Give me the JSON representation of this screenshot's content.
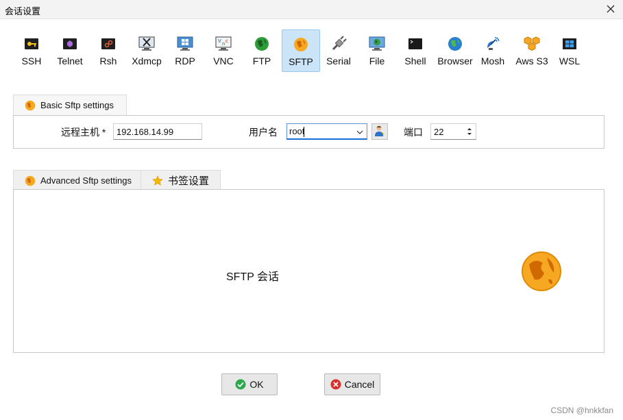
{
  "window": {
    "title": "会话设置"
  },
  "protocols": [
    {
      "label": "SSH",
      "icon": "ssh-key-icon"
    },
    {
      "label": "Telnet",
      "icon": "telnet-icon"
    },
    {
      "label": "Rsh",
      "icon": "rsh-icon"
    },
    {
      "label": "Xdmcp",
      "icon": "xdmcp-icon"
    },
    {
      "label": "RDP",
      "icon": "rdp-windows-icon"
    },
    {
      "label": "VNC",
      "icon": "vnc-icon"
    },
    {
      "label": "FTP",
      "icon": "ftp-globe-icon"
    },
    {
      "label": "SFTP",
      "icon": "sftp-globe-icon",
      "active": true
    },
    {
      "label": "Serial",
      "icon": "serial-plug-icon"
    },
    {
      "label": "File",
      "icon": "file-monitor-icon"
    },
    {
      "label": "Shell",
      "icon": "shell-terminal-icon"
    },
    {
      "label": "Browser",
      "icon": "browser-globe-icon"
    },
    {
      "label": "Mosh",
      "icon": "mosh-satellite-icon"
    },
    {
      "label": "Aws S3",
      "icon": "aws-s3-cubes-icon"
    },
    {
      "label": "WSL",
      "icon": "wsl-windows-icon"
    }
  ],
  "basic_tab": {
    "label": "Basic Sftp settings",
    "remote_host_label": "远程主机 *",
    "remote_host_value": "192.168.14.99",
    "username_label": "用户名",
    "username_value": "root",
    "port_label": "端口",
    "port_value": "22"
  },
  "advanced_tabs": {
    "advanced_label": "Advanced Sftp settings",
    "bookmark_label": "书签设置"
  },
  "session_panel": {
    "label": "SFTP 会话"
  },
  "buttons": {
    "ok": "OK",
    "cancel": "Cancel"
  },
  "watermark": "CSDN @hnkkfan",
  "colors": {
    "active_bg": "#cce4f7",
    "sftp_orange": "#f28c00",
    "ok_green": "#2ea84f",
    "cancel_red": "#d9302c"
  }
}
